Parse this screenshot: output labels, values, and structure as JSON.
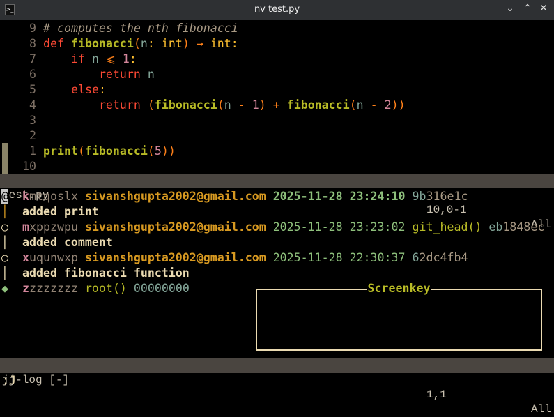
{
  "window": {
    "title": "nv test.py",
    "controls": [
      "⌄",
      "⌃",
      "✕"
    ]
  },
  "editor": {
    "lines": [
      {
        "n": "9",
        "tokens": [
          [
            "cmt",
            "# computes the nth fibonacci"
          ]
        ]
      },
      {
        "n": "8",
        "tokens": [
          [
            "kw",
            "def "
          ],
          [
            "fn",
            "fibonacci"
          ],
          [
            "op",
            "("
          ],
          [
            "pr",
            "n"
          ],
          [
            "ty",
            ": int"
          ],
          [
            "op",
            ") → "
          ],
          [
            "ty",
            "int:"
          ]
        ]
      },
      {
        "n": "7",
        "tokens": [
          [
            "",
            "    "
          ],
          [
            "kw",
            "if "
          ],
          [
            "pr",
            "n "
          ],
          [
            "op",
            "⩽ "
          ],
          [
            "num",
            "1"
          ],
          [
            "ty",
            ":"
          ]
        ]
      },
      {
        "n": "6",
        "tokens": [
          [
            "",
            "        "
          ],
          [
            "kw",
            "return "
          ],
          [
            "pr",
            "n"
          ]
        ]
      },
      {
        "n": "5",
        "tokens": [
          [
            "",
            "    "
          ],
          [
            "kw",
            "else"
          ],
          [
            "ty",
            ":"
          ]
        ]
      },
      {
        "n": "4",
        "tokens": [
          [
            "",
            "        "
          ],
          [
            "kw",
            "return "
          ],
          [
            "op",
            "("
          ],
          [
            "fn",
            "fibonacci"
          ],
          [
            "op",
            "("
          ],
          [
            "pr",
            "n "
          ],
          [
            "op",
            "- "
          ],
          [
            "num",
            "1"
          ],
          [
            "op",
            ") + "
          ],
          [
            "fn",
            "fibonacci"
          ],
          [
            "op",
            "("
          ],
          [
            "pr",
            "n "
          ],
          [
            "op",
            "- "
          ],
          [
            "num",
            "2"
          ],
          [
            "op",
            "))"
          ]
        ]
      },
      {
        "n": "3",
        "tokens": []
      },
      {
        "n": "2",
        "tokens": []
      },
      {
        "n": "1",
        "tokens": [
          [
            "fn",
            "print"
          ],
          [
            "op",
            "("
          ],
          [
            "fn",
            "fibonacci"
          ],
          [
            "op",
            "("
          ],
          [
            "num",
            "5"
          ],
          [
            "op",
            "))"
          ]
        ]
      },
      {
        "n": "10",
        "tokens": []
      }
    ],
    "status": {
      "file": "test.py",
      "pos": "10,0-1",
      "scroll": "All"
    }
  },
  "log": {
    "entries": [
      {
        "glyph": "@",
        "id0": "k",
        "id": "mtqoslx",
        "email": "sivanshgupta2002@gmail.com",
        "date": "2025-11-28 23:24:10",
        "ref": "",
        "h0": "9b",
        "h": "316e1c",
        "desc": "added print"
      },
      {
        "glyph": "○",
        "id0": "m",
        "id": "xppzwpu",
        "email": "sivanshgupta2002@gmail.com",
        "date": "2025-11-28 23:23:02",
        "ref": "git_head()",
        "h0": "eb",
        "h": "1848ec",
        "desc": "added comment"
      },
      {
        "glyph": "○",
        "id0": "x",
        "id": "uqunwxp",
        "email": "sivanshgupta2002@gmail.com",
        "date": "2025-11-28 22:30:37",
        "ref": "",
        "h0": "6",
        "h": "2dc4fb4",
        "desc": "added fibonacci function"
      }
    ],
    "root": {
      "glyph": "◆",
      "id0": "z",
      "id": "zzzzzzz",
      "ref": "root()",
      "hash": "00000000"
    },
    "status": {
      "name": "jj-log [-]",
      "pos": "1,1",
      "scroll": "All"
    }
  },
  "screenkey": {
    "title": "Screenkey"
  },
  "cmdline": ":J"
}
